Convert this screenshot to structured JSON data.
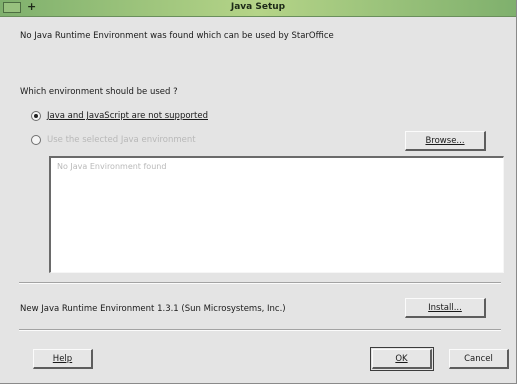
{
  "window": {
    "title": "Java Setup",
    "plus_glyph": "+"
  },
  "message": "No Java Runtime Environment was found which can be used by StarOffice",
  "question": "Which environment should be used ?",
  "options": [
    {
      "label": "Java and JavaScript are not supported",
      "selected": true,
      "enabled": true
    },
    {
      "label": "Use the selected Java environment",
      "selected": false,
      "enabled": false
    }
  ],
  "buttons": {
    "browse": "Browse...",
    "install": "Install...",
    "help": "Help",
    "ok": "OK",
    "cancel": "Cancel"
  },
  "java_list": {
    "placeholder": "No Java Environment found"
  },
  "new_jre_label": "New Java Runtime Environment 1.3.1 (Sun Microsystems, Inc.)"
}
